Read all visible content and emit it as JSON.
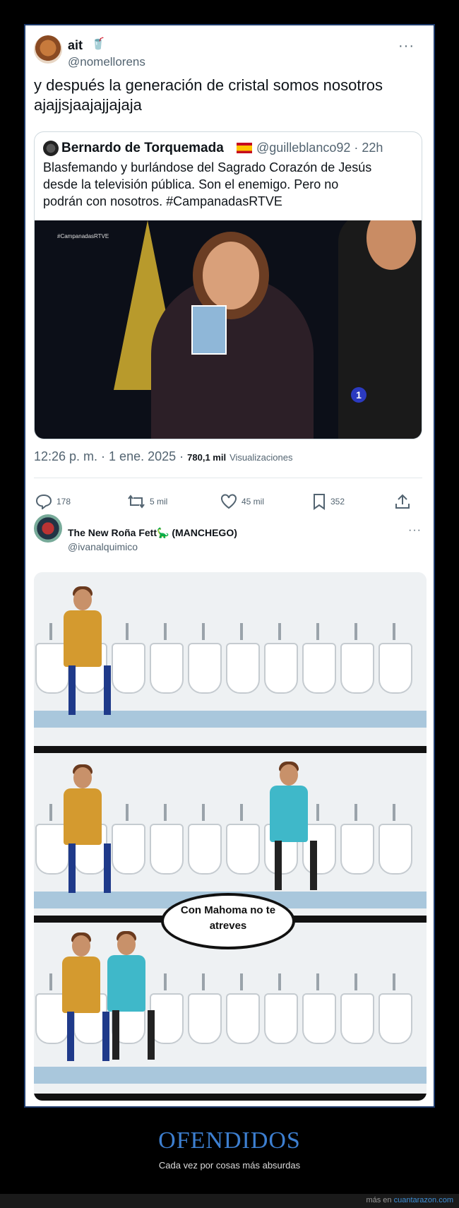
{
  "tweet": {
    "name": "ait",
    "handle": "@nomellorens",
    "text_line1": "y después la generación de cristal somos nosotros",
    "text_line2": "ajajjsjaajajjajaja",
    "more": "···"
  },
  "quote": {
    "name": "Bernardo de Torquemada",
    "handle": "@guilleblanco92 · 22h",
    "line1": "Blasfemando y burlándose del Sagrado Corazón de Jesús",
    "line2": "desde la televisión pública. Son el enemigo. Pero no",
    "line3": "podrán con nosotros. #CampanadasRTVE",
    "overlay_tag": "#CampanadasRTVE",
    "tv_logo": "1"
  },
  "meta": {
    "time": "12:26 p. m. · 1 ene. 2025 ·",
    "views": "780,1 mil",
    "views_label": "Visualizaciones"
  },
  "actions": {
    "replies": "178",
    "retweets": "5 mil",
    "likes": "45 mil",
    "bookmarks": "352"
  },
  "tweet2": {
    "name": "The New Roña Fett🦕 (MANCHEGO)",
    "handle": "@ivanalquimico",
    "more": "···"
  },
  "meme": {
    "bubble_line1": "Con Mahoma no te",
    "bubble_line2": "atreves"
  },
  "footer": {
    "title": "OFENDIDOS",
    "subtitle": "Cada vez por cosas más absurdas",
    "more_prefix": "más en ",
    "site": "cuantarazon.com"
  },
  "colors": {
    "accent": "#3d7fd0",
    "text": "#0f1419",
    "muted": "#536471"
  }
}
